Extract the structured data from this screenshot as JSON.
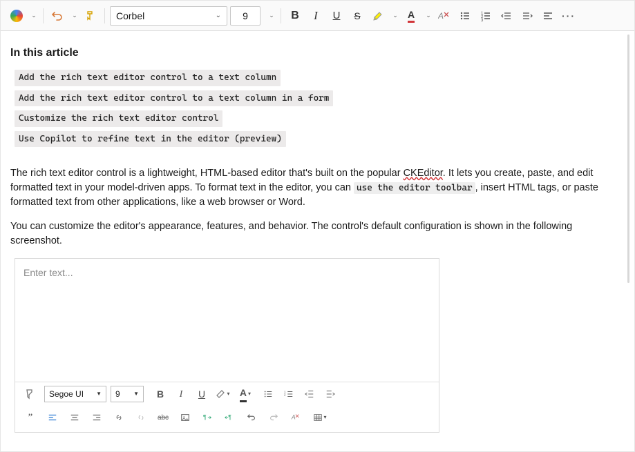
{
  "toolbar": {
    "font_name": "Corbel",
    "font_size": "9"
  },
  "article": {
    "section_title": "In this article",
    "toc": [
      "Add the rich text editor control to a text column",
      "Add the rich text editor control to a text column in a form",
      "Customize the rich text editor control",
      "Use Copilot to refine text in the editor (preview)"
    ],
    "p1_a": "The rich text editor control is a lightweight, HTML-based editor that's built on the popular ",
    "p1_ck": "CKEditor",
    "p1_b": ". It lets you create, paste, and edit formatted text in your model-driven apps. To format text in the editor, you can ",
    "p1_code": "use the editor toolbar",
    "p1_c": ", insert HTML tags, or paste formatted text from other applications, like a web browser or Word.",
    "p2": "You can customize the editor's appearance, features, and behavior. The control's default configuration is shown in the following screenshot."
  },
  "inner": {
    "placeholder": "Enter text...",
    "font_name": "Segoe UI",
    "font_size": "9"
  }
}
